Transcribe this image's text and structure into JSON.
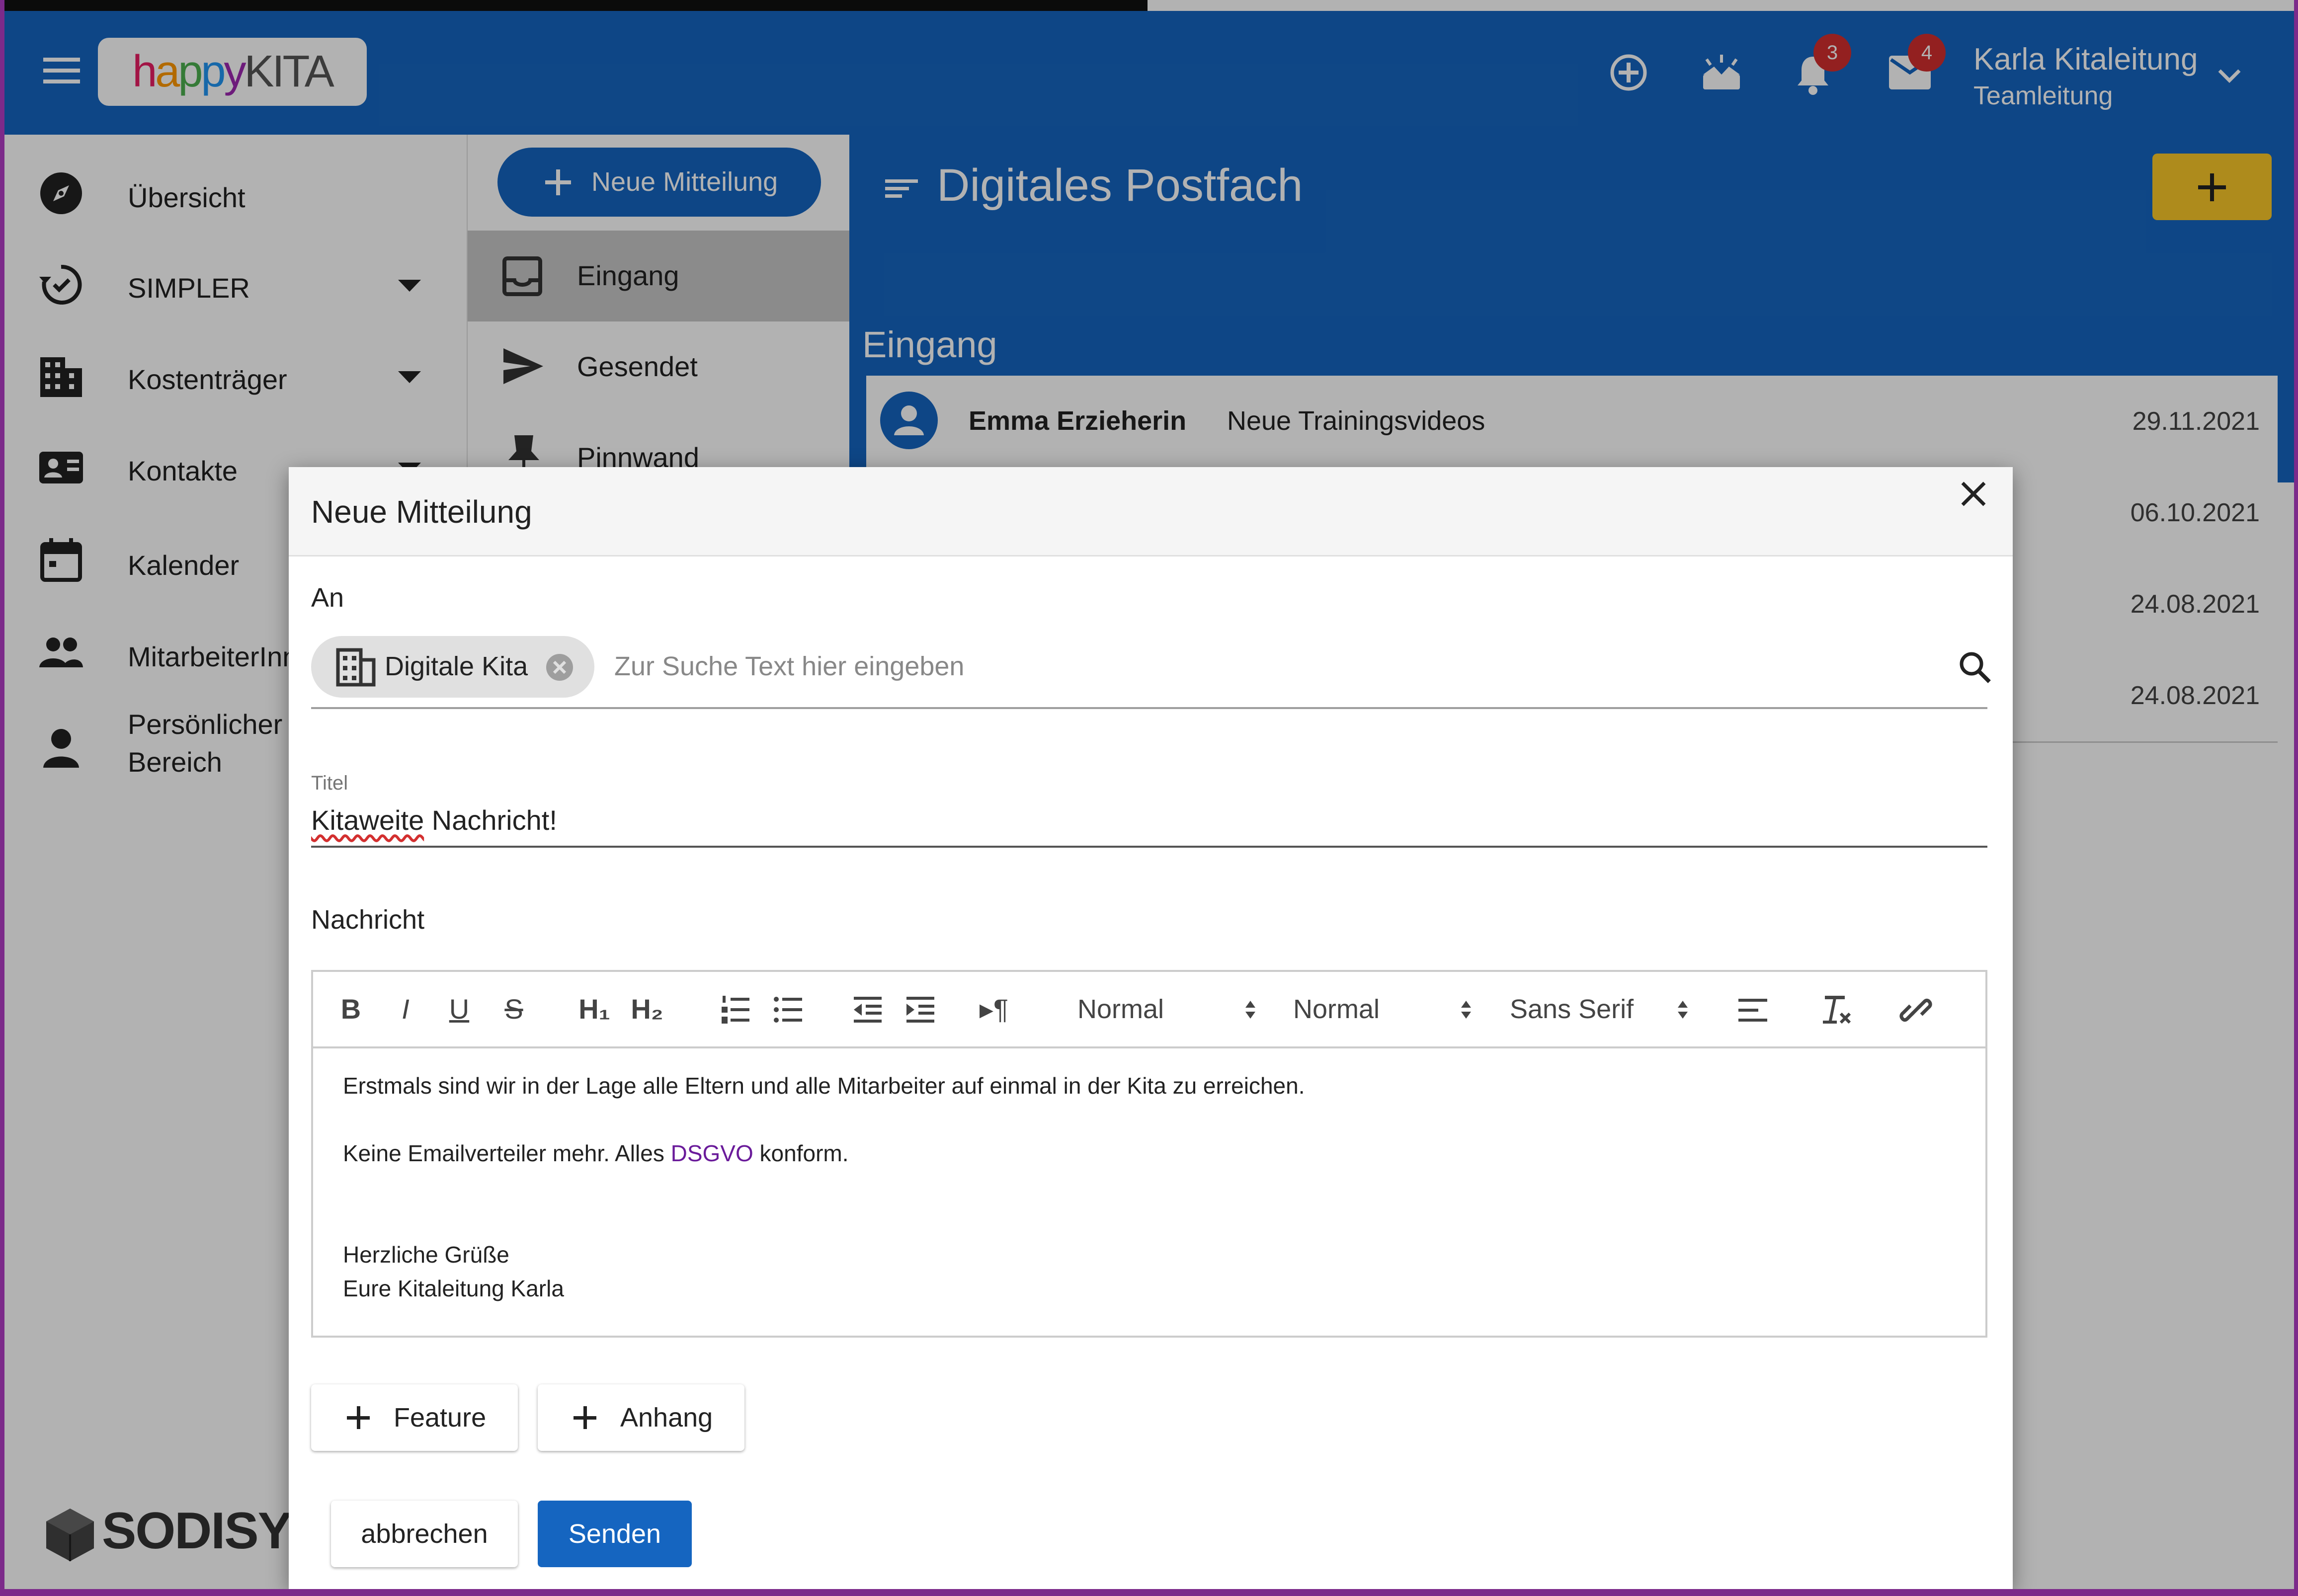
{
  "app": {
    "logo": {
      "happy_h": "h",
      "happy_a": "a",
      "happy_p1": "p",
      "happy_p2": "p",
      "happy_y": "y",
      "kita": "KITA"
    },
    "badges": {
      "notifications": "3",
      "messages": "4"
    },
    "user": {
      "name": "Karla Kitaleitung",
      "role": "Teamleitung"
    }
  },
  "sidebar": {
    "items": [
      {
        "label": "Übersicht",
        "icon": "compass-icon"
      },
      {
        "label": "SIMPLER",
        "icon": "sync-check-icon",
        "expandable": true
      },
      {
        "label": "Kostenträger",
        "icon": "building-icon",
        "expandable": true
      },
      {
        "label": "Kontakte",
        "icon": "contact-card-icon",
        "expandable": true
      },
      {
        "label": "Kalender",
        "icon": "calendar-icon"
      },
      {
        "label": "MitarbeiterInnen",
        "icon": "people-icon"
      },
      {
        "label_line1": "Persönlicher",
        "label_line2": "Bereich",
        "icon": "person-icon"
      }
    ],
    "brand": "SODISYS"
  },
  "folders": {
    "new_message": "Neue Mitteilung",
    "items": [
      {
        "label": "Eingang",
        "icon": "inbox-icon",
        "active": true
      },
      {
        "label": "Gesendet",
        "icon": "send-icon"
      },
      {
        "label": "Pinnwand",
        "icon": "pin-icon"
      }
    ]
  },
  "main": {
    "title": "Digitales Postfach",
    "section": "Eingang",
    "messages": [
      {
        "sender": "Emma Erzieherin",
        "subject": "Neue Trainingsvideos",
        "date": "29.11.2021"
      },
      {
        "date": "06.10.2021"
      },
      {
        "date": "24.08.2021"
      },
      {
        "date": "24.08.2021"
      }
    ]
  },
  "dialog": {
    "title": "Neue Mitteilung",
    "to_label": "An",
    "recipient_chip": "Digitale Kita",
    "search_placeholder": "Zur Suche Text hier eingeben",
    "title_label": "Titel",
    "title_value_spell": "Kitaweite",
    "title_value_rest": " Nachricht!",
    "message_label": "Nachricht",
    "toolbar": {
      "bold": "B",
      "italic": "I",
      "underline": "U",
      "strike": "S",
      "h1": "H₁",
      "h2": "H₂",
      "rtl": "▸¶",
      "size_select": "Normal",
      "header_select": "Normal",
      "font_select": "Sans Serif"
    },
    "body": {
      "line1": "Erstmals sind wir in der Lage alle Eltern und alle Mitarbeiter auf einmal in der Kita zu erreichen.",
      "line2_pre": "Keine Emailverteiler mehr. Alles ",
      "line2_link": "DSGVO",
      "line2_post": " konform.",
      "line3": "Herzliche Grüße",
      "line4": "Eure Kitaleitung Karla"
    },
    "feature_button": "Feature",
    "attachment_button": "Anhang",
    "cancel_button": "abbrechen",
    "send_button": "Senden"
  },
  "colors": {
    "primary": "#1565c0",
    "accent": "#f9c829",
    "badge": "#d32f2f",
    "link": "#6a1b9a"
  }
}
